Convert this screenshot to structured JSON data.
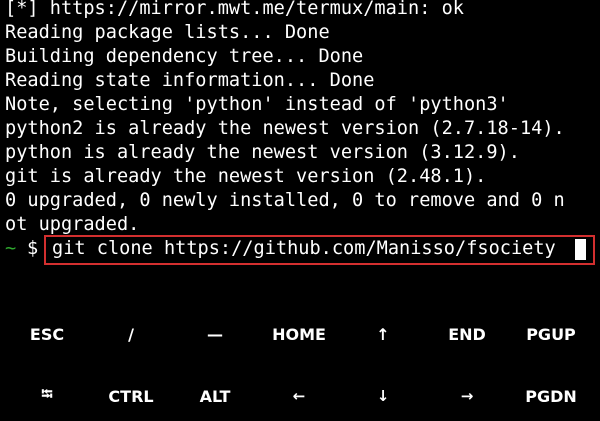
{
  "terminal": {
    "lines": [
      "[*] https://mirror.mwt.me/termux/main: ok",
      "Reading package lists... Done",
      "Building dependency tree... Done",
      "Reading state information... Done",
      "Note, selecting 'python' instead of 'python3'",
      "python2 is already the newest version (2.7.18-14).",
      "python is already the newest version (3.12.9).",
      "git is already the newest version (2.48.1).",
      "0 upgraded, 0 newly installed, 0 to remove and 0 n",
      "ot upgraded."
    ],
    "prompt_arrow": "~",
    "prompt_sign": "$",
    "command": "git clone https://github.com/Manisso/fsociety"
  },
  "extra_keys": {
    "row1": [
      "ESC",
      "/",
      "—",
      "HOME",
      "↑",
      "END",
      "PGUP"
    ],
    "row2": [
      "⭾",
      "CTRL",
      "ALT",
      "←",
      "↓",
      "→",
      "PGDN"
    ]
  },
  "colors": {
    "background": "#000000",
    "text": "#ffffff",
    "prompt_arrow": "#2ea82e",
    "highlight_border": "#d32f2f"
  }
}
